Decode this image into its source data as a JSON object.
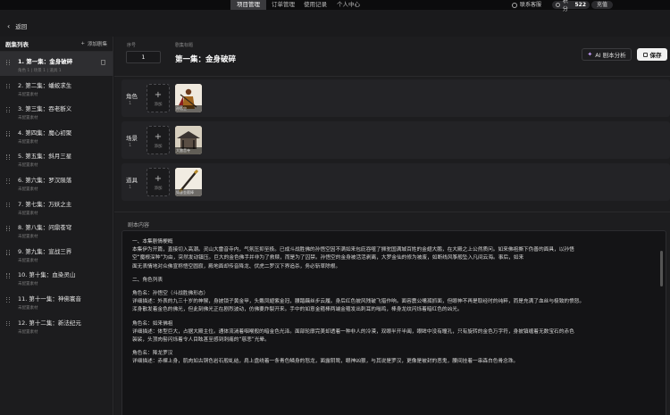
{
  "topnav": {
    "tabs": [
      "项目管理",
      "订单管理",
      "使用记录",
      "个人中心"
    ],
    "support": "联系客服",
    "points_label": "积分",
    "points_value": "522",
    "recharge": "充值"
  },
  "back_label": "返回",
  "sidebar": {
    "title": "剧集列表",
    "add_label": "添加剧集",
    "episodes": [
      {
        "title": "1. 第一集：金身破碎",
        "sub": "角色 1 | 场景 1 | 道具 1"
      },
      {
        "title": "2. 第二集：蟠蛟求生",
        "sub": "未配置素材"
      },
      {
        "title": "3. 第三集：吞老断义",
        "sub": "未配置素材"
      },
      {
        "title": "4. 第四集：魔心初聚",
        "sub": "未配置素材"
      },
      {
        "title": "5. 第五集：斜月三星",
        "sub": "未配置素材"
      },
      {
        "title": "6. 第六集：罗汉陨落",
        "sub": "未配置素材"
      },
      {
        "title": "7. 第七集：万妖之主",
        "sub": "未配置素材"
      },
      {
        "title": "8. 第八集：问鼎苍穹",
        "sub": "未配置素材"
      },
      {
        "title": "9. 第九集：宣战三界",
        "sub": "未配置素材"
      },
      {
        "title": "10. 第十集：血染灵山",
        "sub": "未配置素材"
      },
      {
        "title": "11. 第十一集：神佛寰音",
        "sub": "未配置素材"
      },
      {
        "title": "12. 第十二集：新法纪元",
        "sub": "未配置素材"
      }
    ]
  },
  "header": {
    "num_label": "序号",
    "num_value": "1",
    "title_label": "剧集标题",
    "title_value": "第一集：金身破碎",
    "ai_button": "AI 剧本分析",
    "save_button": "保存"
  },
  "assets": [
    {
      "name": "角色",
      "count": "1",
      "add": "添加",
      "caption": "孙悟空"
    },
    {
      "name": "场景",
      "count": "1",
      "add": "添加",
      "caption": "大雷音寺"
    },
    {
      "name": "道具",
      "count": "1",
      "add": "添加",
      "caption": "如意金箍棒"
    }
  ],
  "script": {
    "label": "剧本内容",
    "lines": [
      "一、本集剧情梗概",
      "本集伊为开篇，直接切入高潮。灵山大雷音寺内，气氛压抑至极。已成斗战胜佛的孙悟空因不满如来包庇吞噬了狮驼国满城百姓的金翅大鹏，在大殿之上公然质问。如来佛祖撕下伪善的面具，以孙悟",
      "空“魔根深种”为由，突然发动镇压。巨大的金色佛手并非为了救赎，而是为了囚禁。孙悟空的金身被活活剥离，大罗金仙的修为被废，如断线风筝般坠入凡间云海。事后，如来",
      "面无表情地对众佛宣称悟空圆寂，殿地面却传音降龙、伏虎二罗汉下界追杀，务必斩草除根。",
      "二、角色列表",
      "角色名：孙悟空（斗战胜佛形态）",
      "详细描述：外表的九三十岁的神猴，身披锁子黄金甲，头戴凤翅紫金冠，腰踏藕丝步云履。身后红色披风残破飞猎作响。面容震公嘴孤抓面，但眼神不再是取经时的纯粹，而是充满了血丝与极致的愤怒。",
      "浑身散发着金色的佛光，但此刻佛光正在剧烈波动，仿佛要炸裂开来。手中的如意金箍棒两端金箍发出刺耳的嗡鸣，棒身龙纹闪烁着暗红色的凶光。",
      "角色名：如来佛祖",
      "详细描述：体型巨大，占据大殿主位。通体流淌着咽喉般的暗金色光泽。面部轮廓完美却透着一种非人的冷漠，双眼半开半阖，眼眸中没有瞳孔，只有旋转的金色万字符，身披镇缠着无数宝石的赤色",
      "袈裟，头顶肉髻闪烁着令人目眩甚至感到刺痛的“慈悲”光晕。",
      "角色名：降龙罗汉",
      "详细描述：赤裸上身，肌肉如古铜色岩石般虬结，肩上盘绕着一条青色鳞身的怒龙，面露阴鸷，眼神凶狠，与其说是罗汉，更像是被封的恶鬼，腰间挂着一串森白色骨念珠。"
    ]
  }
}
